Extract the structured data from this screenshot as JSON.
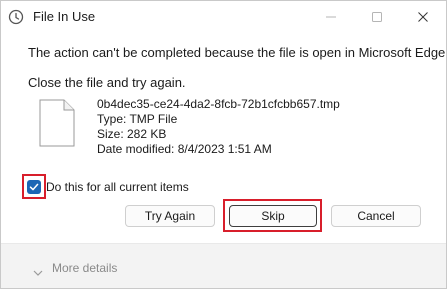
{
  "window": {
    "title": "File In Use"
  },
  "message": {
    "text": "The action can't be completed because the file is open in Microsoft Edge",
    "instruction": "Close the file and try again."
  },
  "file": {
    "name": "0b4dec35-ce24-4da2-8fcb-72b1cfcbb657.tmp",
    "type": "Type: TMP File",
    "size": "Size: 282 KB",
    "date_modified": "Date modified: 8/4/2023 1:51 AM"
  },
  "checkbox": {
    "label": "Do this for all current items",
    "checked": true
  },
  "buttons": {
    "try_again": "Try Again",
    "skip": "Skip",
    "cancel": "Cancel"
  },
  "footer": {
    "more_details": "More details"
  },
  "colors": {
    "accent": "#1c66b5",
    "highlight": "#d81e2b",
    "footer_bg": "#f3f3f3"
  },
  "icons": [
    "file-in-use-app-icon",
    "minimize-icon",
    "maximize-icon",
    "close-icon",
    "file-icon",
    "checkmark-icon",
    "chevron-down-icon"
  ]
}
